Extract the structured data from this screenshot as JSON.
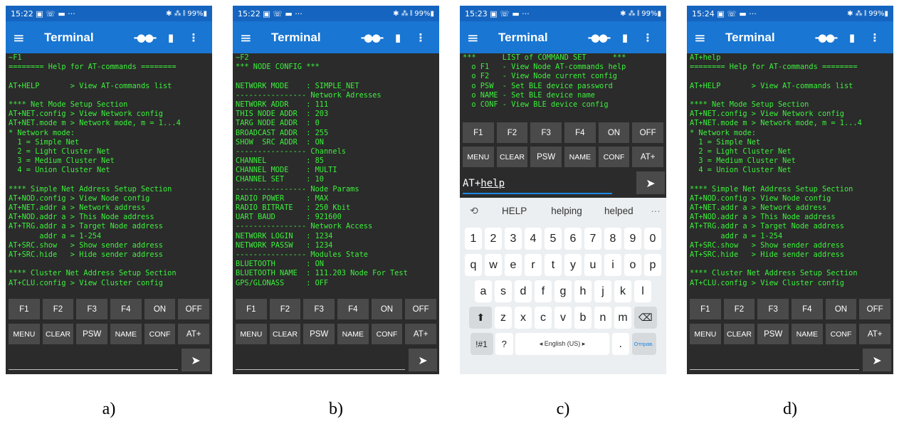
{
  "statusbar": {
    "icons": "▣ ☏ ▬ ···",
    "right": "✱ ⁂ 𝄃 99%▮",
    "time_a": "15:22",
    "time_b": "15:22",
    "time_c": "15:23",
    "time_d": "15:24"
  },
  "appbar": {
    "title": "Terminal",
    "menu_icon": "≡",
    "plug_icon": "-●●-",
    "trash_icon": "▮",
    "more_icon": "⋮"
  },
  "keys_row1": [
    "F1",
    "F2",
    "F3",
    "F4",
    "ON",
    "OFF"
  ],
  "keys_row2": [
    "MENU",
    "CLEAR",
    "PSW",
    "NAME",
    "CONF",
    "AT+"
  ],
  "send_icon": "➤",
  "screens": {
    "a": {
      "caption": "a)",
      "lines": [
        "~F1",
        "======== Help for AT-commands ========",
        "",
        "AT+HELP       > View AT-commands list",
        "",
        "**** Net Mode Setup Section",
        "AT+NET.config > View Network config",
        "AT+NET.mode m > Network mode, m = 1...4",
        "* Network mode:",
        "  1 = Simple Net",
        "  2 = Light Cluster Net",
        "  3 = Medium Cluster Net",
        "  4 = Union Cluster Net",
        "",
        "**** Simple Net Address Setup Section",
        "AT+NOD.config > View Node config",
        "AT+NET.addr a > Network address",
        "AT+NOD.addr a > This Node address",
        "AT+TRG.addr a > Target Node address",
        "       addr a = 1-254",
        "AT+SRC.show   > Show sender address",
        "AT+SRC.hide   > Hide sender address",
        "",
        "**** Cluster Net Address Setup Section",
        "AT+CLU.config > View Cluster config"
      ]
    },
    "b": {
      "caption": "b)",
      "lines": [
        "~F2",
        "*** NODE CONFIG ***",
        "",
        "NETWORK MODE    : SIMPLE_NET",
        "---------------- Network Adresses",
        "NETWORK ADDR    : 111",
        "THIS NODE ADDR  : 203",
        "TARG NODE ADDR  : 0",
        "BROADCAST ADDR  : 255",
        "SHOW  SRC ADDR  : ON",
        "---------------- Channels",
        "CHANNEL         : 85",
        "CHANNEL MODE    : MULTI",
        "CHANNEL SET     : 10",
        "---------------- Node Params",
        "RADIO POWER     : MAX",
        "RADIO BITRATE   : 250 Kbit",
        "UART BAUD       : 921600",
        "---------------- Network Access",
        "NETWORK LOGIN   : 1234",
        "NETWORK PASSW   : 1234",
        "---------------- Modules State",
        "BLUETOOTH       : ON",
        "BLUETOOTH NAME  : 111.203 Node For Test",
        "GPS/GLONASS     : OFF"
      ]
    },
    "c": {
      "caption": "c)",
      "lines": [
        "***      LIST of COMMAND SET      ***",
        "  o F1   - View Node AT-commands help",
        "  o F2   - View Node current config",
        "  o PSW  - Set BLE device password",
        "  o NAME - Set BLE device name",
        "  o CONF - View BLE device config"
      ],
      "input_prefix": "AT+",
      "input_word": "help",
      "suggestions": [
        "HELP",
        "helping",
        "helped"
      ],
      "suggest_icon": "⟲",
      "more": "···",
      "kb_row1": [
        "1",
        "2",
        "3",
        "4",
        "5",
        "6",
        "7",
        "8",
        "9",
        "0"
      ],
      "kb_row2": [
        "q",
        "w",
        "e",
        "r",
        "t",
        "y",
        "u",
        "i",
        "o",
        "p"
      ],
      "kb_row3": [
        "a",
        "s",
        "d",
        "f",
        "g",
        "h",
        "j",
        "k",
        "l"
      ],
      "kb_row4": [
        "z",
        "x",
        "c",
        "v",
        "b",
        "n",
        "m"
      ],
      "shift": "⬆",
      "backspace": "⌫",
      "sym": "!#1",
      "question": "?",
      "space": "◂ English (US) ▸",
      "dot": ".",
      "go": "Отправ."
    },
    "d": {
      "caption": "d)",
      "lines": [
        "AT+help",
        "======== Help for AT-commands ========",
        "",
        "AT+HELP       > View AT-commands list",
        "",
        "**** Net Mode Setup Section",
        "AT+NET.config > View Network config",
        "AT+NET.mode m > Network mode, m = 1...4",
        "* Network mode:",
        "  1 = Simple Net",
        "  2 = Light Cluster Net",
        "  3 = Medium Cluster Net",
        "  4 = Union Cluster Net",
        "",
        "**** Simple Net Address Setup Section",
        "AT+NOD.config > View Node config",
        "AT+NET.addr a > Network address",
        "AT+NOD.addr a > This Node address",
        "AT+TRG.addr a > Target Node address",
        "       addr a = 1-254",
        "AT+SRC.show   > Show sender address",
        "AT+SRC.hide   > Hide sender address",
        "",
        "**** Cluster Net Address Setup Section",
        "AT+CLU.config > View Cluster config"
      ]
    }
  }
}
